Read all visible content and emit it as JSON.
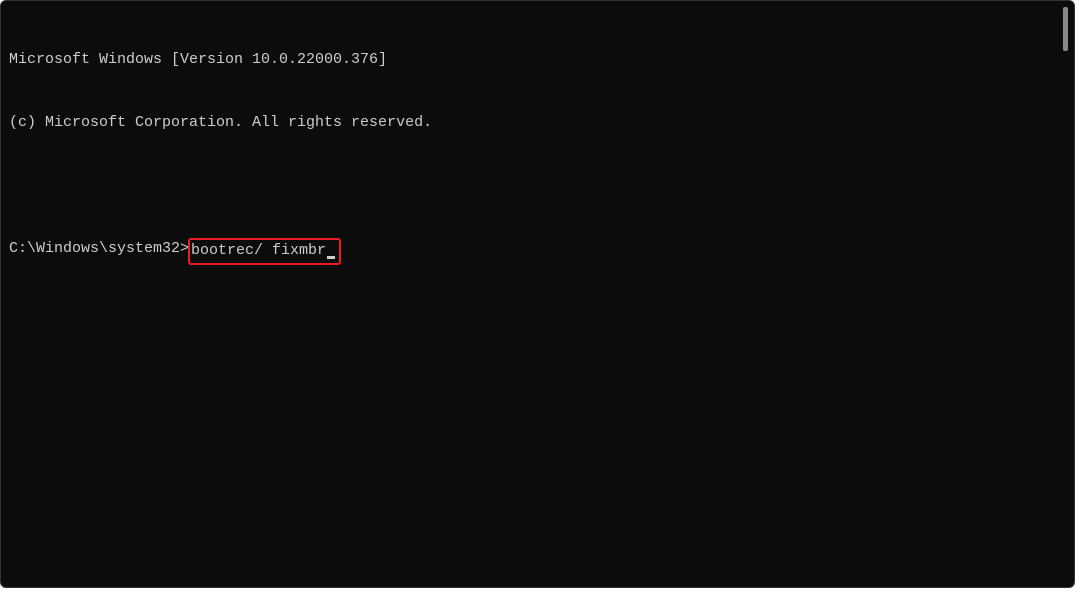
{
  "terminal": {
    "header_line1": "Microsoft Windows [Version 10.0.22000.376]",
    "header_line2": "(c) Microsoft Corporation. All rights reserved.",
    "prompt_path": "C:\\Windows\\system32>",
    "command": "bootrec/ fixmbr"
  }
}
